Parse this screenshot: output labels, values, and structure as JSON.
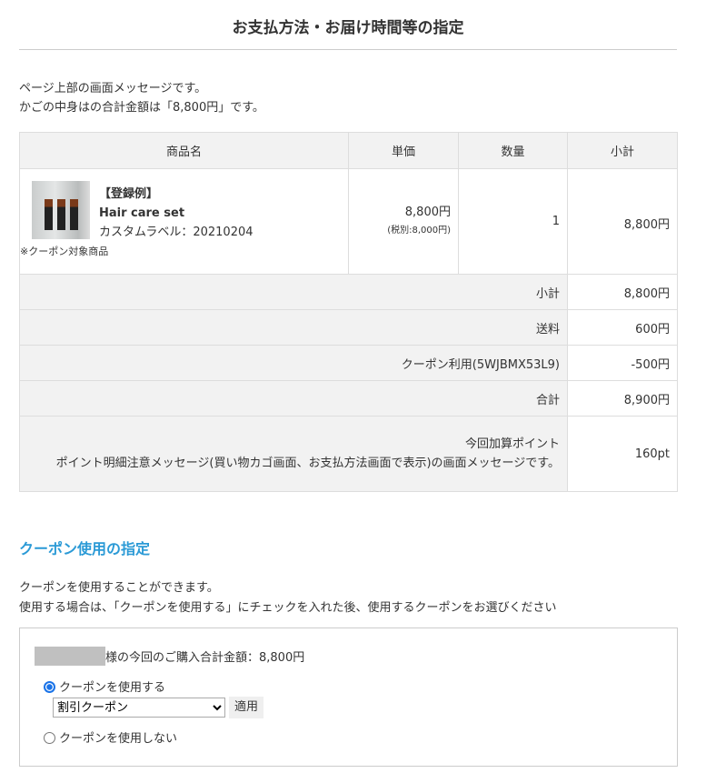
{
  "title": "お支払方法・お届け時間等の指定",
  "messages": [
    "ページ上部の画面メッセージです。",
    "かごの中身はの合計金額は「8,800円」です。"
  ],
  "table": {
    "headers": [
      "商品名",
      "単価",
      "数量",
      "小計"
    ],
    "item": {
      "tag": "【登録例】",
      "name": "Hair care set",
      "label": "カスタムラベル：20210204",
      "note": "※クーポン対象商品",
      "price": "8,800円",
      "price_ex_tax": "(税別:8,000円)",
      "qty": "1",
      "subtotal": "8,800円"
    },
    "summary": [
      {
        "label": "小計",
        "value": "8,800円"
      },
      {
        "label": "送料",
        "value": "600円"
      },
      {
        "label": "クーポン利用(5WJBMX53L9)",
        "value": "-500円"
      },
      {
        "label": "合計",
        "value": "8,900円"
      }
    ],
    "points": {
      "label": "今回加算ポイント",
      "message": "ポイント明細注意メッセージ(買い物カゴ画面、お支払方法画面で表示)の画面メッセージです。",
      "value": "160pt"
    }
  },
  "coupon": {
    "heading": "クーポン使用の指定",
    "messages": [
      "クーポンを使用することができます。",
      "使用する場合は、「クーポンを使用する」にチェックを入れた後、使用するクーポンをお選びください"
    ],
    "total_text": "様の今回のご購入合計金額：8,800円",
    "use_label": "クーポンを使用する",
    "selected_coupon": "割引クーポン",
    "apply_label": "適用",
    "no_use_label": "クーポンを使用しない"
  }
}
